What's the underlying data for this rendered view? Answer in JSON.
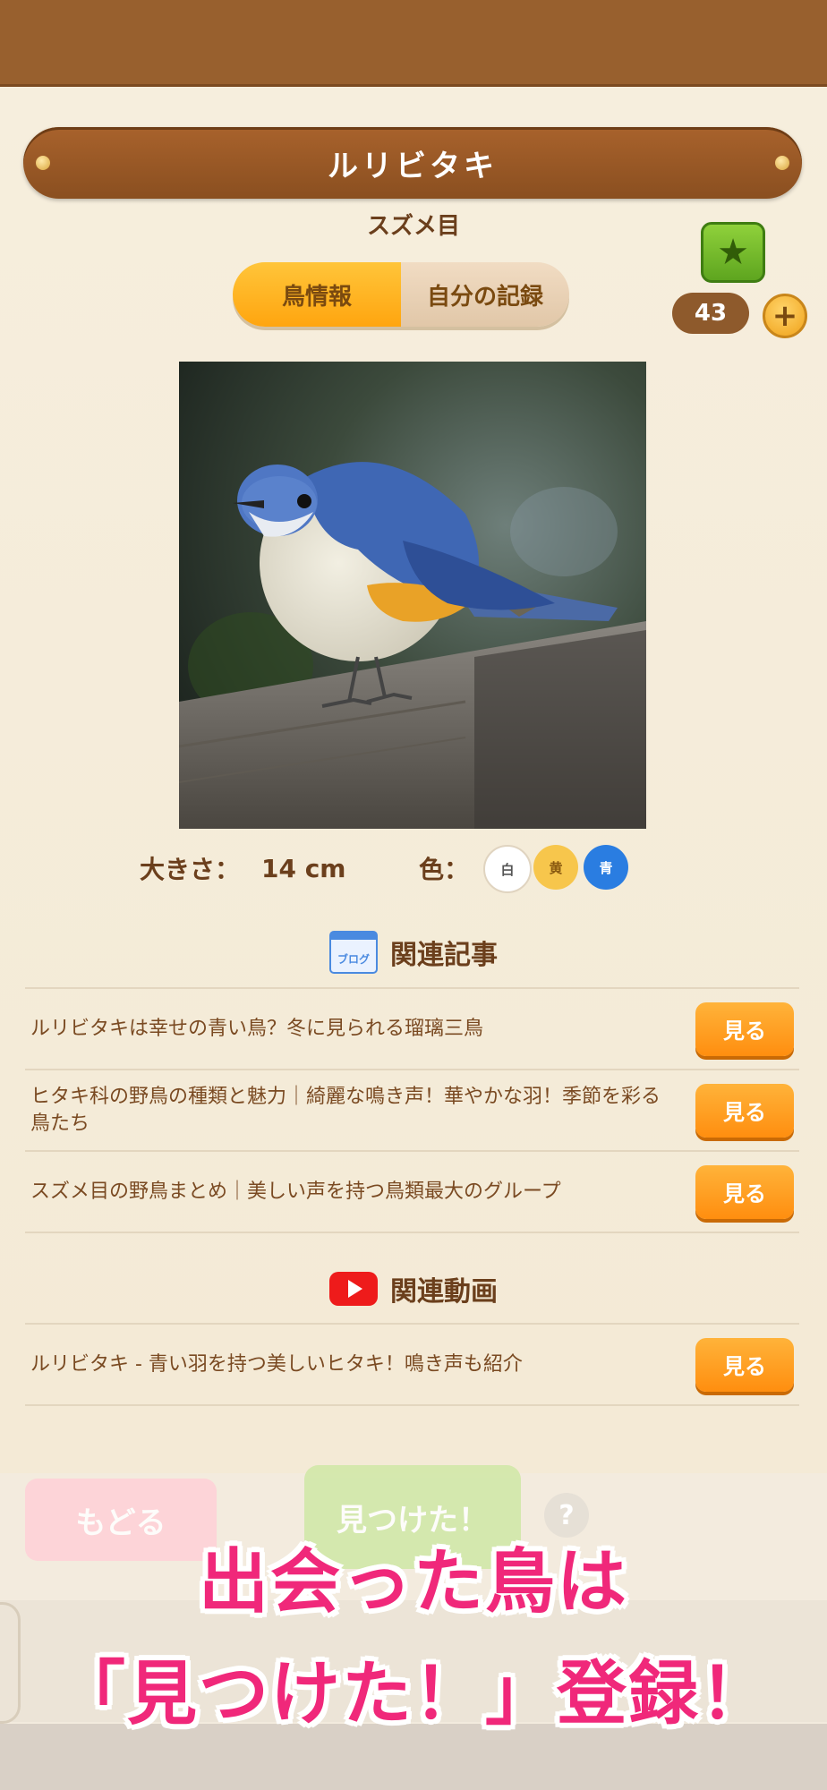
{
  "header": {
    "title": "ルリビタキ",
    "order": "スズメ目"
  },
  "favorite": {
    "icon": "star-icon",
    "count": "43",
    "add_label": "+"
  },
  "tabs": [
    {
      "label": "鳥情報",
      "active": true
    },
    {
      "label": "自分の記録",
      "active": false
    }
  ],
  "details": {
    "size_label": "大きさ：",
    "size_value": "14 cm",
    "color_label": "色：",
    "colors": [
      {
        "label": "白",
        "hex": "#ffffff"
      },
      {
        "label": "黄",
        "hex": "#f7c64c"
      },
      {
        "label": "青",
        "hex": "#2a7de1"
      }
    ]
  },
  "articles": {
    "icon_text": "ブログ",
    "heading": "関連記事",
    "items": [
      {
        "title": "ルリビタキは幸せの青い鳥？冬に見られる瑠璃三鳥",
        "button": "見る"
      },
      {
        "title": "ヒタキ科の野鳥の種類と魅力｜綺麗な鳴き声！華やかな羽！季節を彩る鳥たち",
        "button": "見る"
      },
      {
        "title": "スズメ目の野鳥まとめ｜美しい声を持つ鳥類最大のグループ",
        "button": "見る"
      }
    ]
  },
  "videos": {
    "heading": "関連動画",
    "items": [
      {
        "title": "ルリビタキ - 青い羽を持つ美しいヒタキ！鳴き声も紹介",
        "button": "見る"
      }
    ]
  },
  "actions": {
    "back": "もどる",
    "found": "見つけた！",
    "help": "?"
  },
  "promo": {
    "line1": "出会った鳥は",
    "line2": "「見つけた！」登録！"
  }
}
